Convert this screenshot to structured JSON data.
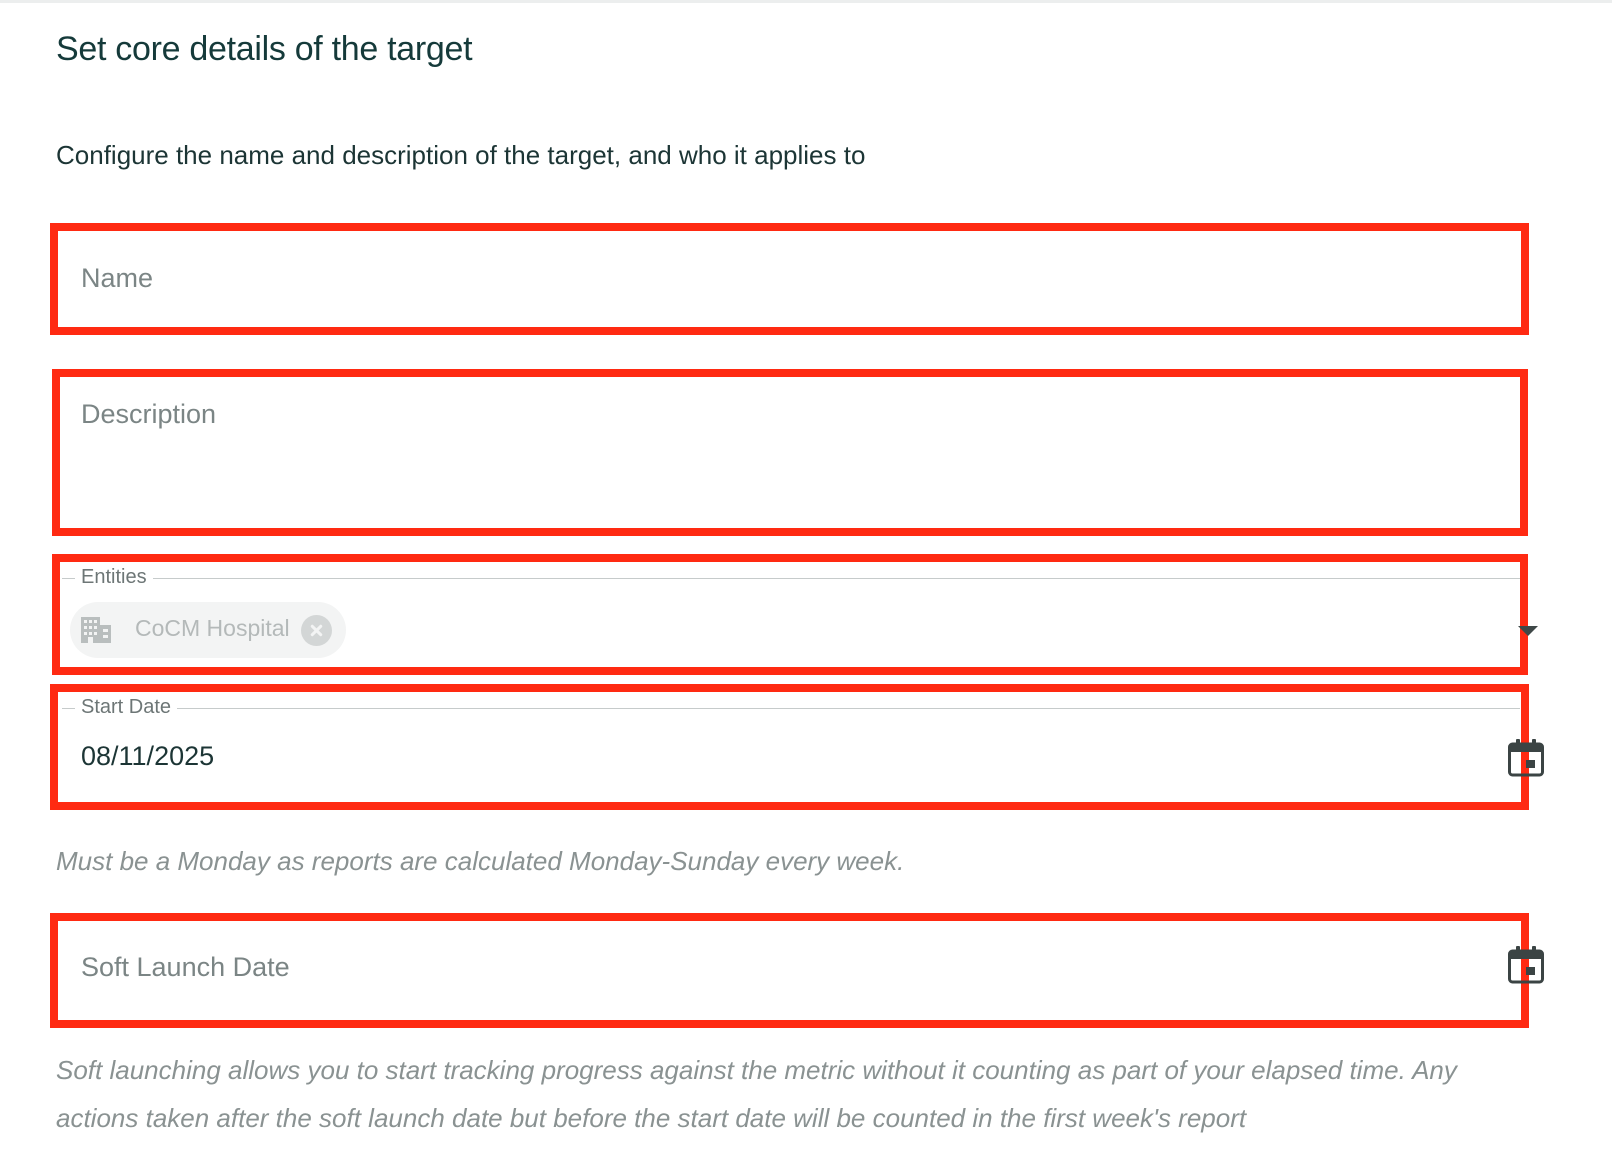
{
  "form": {
    "title": "Set core details of the target",
    "subtitle": "Configure the name and description of the target, and who it applies to",
    "name_field": {
      "placeholder": "Name",
      "value": ""
    },
    "description_field": {
      "placeholder": "Description",
      "value": ""
    },
    "entities_field": {
      "label": "Entities",
      "chips": [
        {
          "label": "CoCM Hospital",
          "icon": "building-icon"
        }
      ],
      "dropdown_icon": "chevron-down-icon"
    },
    "start_date_field": {
      "label": "Start Date",
      "value": "08/11/2025",
      "icon": "calendar-icon"
    },
    "start_date_helper": "Must be a Monday as reports are calculated Monday-Sunday every week.",
    "soft_launch_field": {
      "placeholder": "Soft Launch Date",
      "value": "",
      "icon": "calendar-icon"
    },
    "soft_launch_helper": "Soft launching allows you to start tracking progress against the metric without it counting as part of your elapsed time. Any actions taken after the soft launch date but before the start date will be counted in the first week's report"
  },
  "colors": {
    "highlight": "#ff2a12",
    "heading": "#153a3a",
    "helper_text": "#8a9292",
    "chip_background": "#f3f4f4"
  }
}
